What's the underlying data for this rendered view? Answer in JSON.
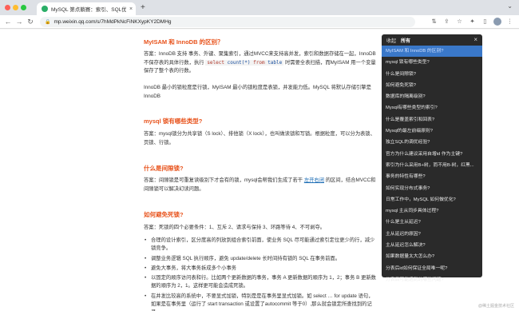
{
  "browser": {
    "tab_title": "MySQL 第点躺赛：索引、SQL优...",
    "tab_close": "×",
    "new_tab": "+",
    "url": "mp.weixin.qq.com/s/7hMdPkNcFiNKXypKY2DMHg"
  },
  "article": {
    "s1_title": "MyISAM 和 InnoDB 的区别？",
    "s1_p1_a": "答案：InnoDB 支持 事务、外键、聚集索引，通过MVCC来支持高并发，索引和数据存储在一起，InnoDB 不保存表的具体行数，执行 ",
    "s1_p1_code_kw1": "select",
    "s1_p1_code_mid": " count(*) ",
    "s1_p1_code_kw2": "from",
    "s1_p1_code_end": " table",
    "s1_p1_b": " 时需要全表扫描，而MyISAM 用一个变量保存了整个表的行数。",
    "s1_p2": "InnoDB 最小的锁粒度是行锁，MyISAM 最小的锁粒度是表锁，并发能力低。MySQL 将默认存储引擎是 InnoDB",
    "s2_title": "mysql 锁有哪些类型?",
    "s2_p": "答案：mysql锁分为共享锁（S lock）、排他锁（X lock），也叫做读锁和写锁。根据粒度，可以分为表锁、页锁、行锁。",
    "s3_title": "什么是间隙锁?",
    "s3_p_a": "答案：间隙锁是可重复读级别下才会有的锁，mysql会帮我们生成了若干 ",
    "s3_p_hl": "左开右闭",
    "s3_p_b": " 的区间，结合MVCC和间隙锁可以解决幻读问题。",
    "s4_title": "如何避免死锁?",
    "s4_p": "答案：死锁的四个必要条件：1、互斥 2、请求与保持 3、环路等待 4、不可剥夺。",
    "s4_bullets": [
      "合理的设计索引，区分度高的列放到组合索引前面，使业务 SQL 尽可能通过索引定位更少的行，减少锁竞争。",
      "调整业务逻辑 SQL 执行顺序，避免 update/delete 长时间持有锁的 SQL 在事务前面。",
      "避免大事务，将大事务拆成多个小事务",
      "以固定的顺序访问表和行。比如两个更新数据的事务，事务 A 更新数据的顺序为 1，2；事务 B 更新数据的顺序为 2，1。这样更可能会造成死锁。",
      "在并发比较高的系统中，不要显式加锁，特别是是在事务里显式加锁。如 select … for update 语句，如果是在事务里（运行了 start transaction 或设置了autocommit 等于0）,那么就会锁定所查找到的记录。"
    ]
  },
  "toc": {
    "tab_active": "收起",
    "tab_all": "所有",
    "close": "×",
    "items": [
      "MyISAM 和 InnoDB 的区别?",
      "mysql 锁有哪些类型?",
      "什么是间隙锁?",
      "如何避免死锁?",
      "数据库的隔离级别?",
      "Mysql有哪些类型的索引?",
      "什么是覆盖索引和回表?",
      "Mysql的最左前缀原则?",
      "独立SQL的调优经验?",
      "官方为什么建议采用自增id 作为主键?",
      "索引为什么采用B+树，而不用B-树，红黑...",
      "事务的特性有哪些?",
      "如何实现分布式事务?",
      "日常工作中，MySQL 如何做优化?",
      "mysql 主从同步具体过程?",
      "什么是主从延迟?",
      "主从延迟的原因?",
      "主从延迟怎么解决?",
      "如果数据量太大怎么办?",
      "分表后id如何保证全局唯一呢?",
      "分表后可能遇到的哪些问题?"
    ]
  },
  "watermark": "@稀土掘金技术社区"
}
